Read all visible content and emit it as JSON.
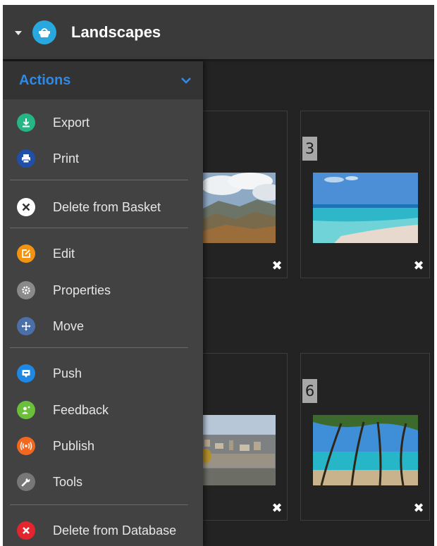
{
  "header": {
    "title": "Landscapes",
    "basket_icon": "basket-icon"
  },
  "tiles": [
    {
      "number": "3"
    },
    {
      "number": "6"
    }
  ],
  "menu": {
    "title": "Actions",
    "items": [
      {
        "label": "Export",
        "icon": "download-icon",
        "color": "#26b585"
      },
      {
        "label": "Print",
        "icon": "print-icon",
        "color": "#1f4fa8"
      },
      {
        "label": "Delete from Basket",
        "icon": "close-circle-icon",
        "color": "#ffffff"
      },
      {
        "label": "Edit",
        "icon": "edit-icon",
        "color": "#f39312"
      },
      {
        "label": "Properties",
        "icon": "gear-icon",
        "color": "#8a8a8a"
      },
      {
        "label": "Move",
        "icon": "move-icon",
        "color": "#4b6fa8"
      },
      {
        "label": "Push",
        "icon": "push-icon",
        "color": "#1e88e5"
      },
      {
        "label": "Feedback",
        "icon": "feedback-icon",
        "color": "#6bbf3a"
      },
      {
        "label": "Publish",
        "icon": "broadcast-icon",
        "color": "#f2681f"
      },
      {
        "label": "Tools",
        "icon": "wrench-icon",
        "color": "#777777"
      },
      {
        "label": "Delete from Database",
        "icon": "delete-icon",
        "color": "#e3262e"
      }
    ]
  }
}
